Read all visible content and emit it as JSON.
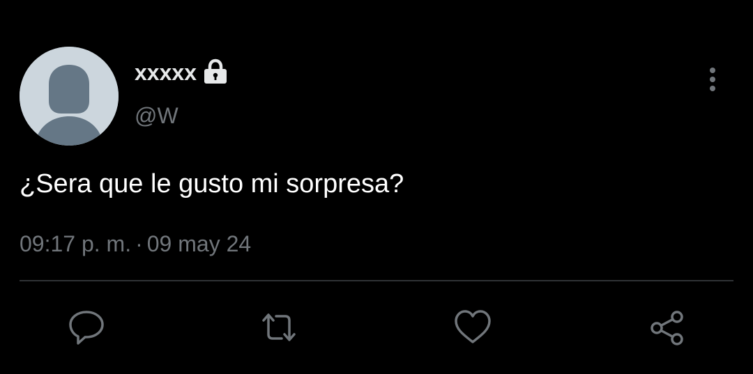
{
  "colors": {
    "background": "#000000",
    "text_primary": "#ffffff",
    "text_secondary": "#71767b",
    "divider": "#2f3336",
    "avatar_bg": "#ccd6dd",
    "avatar_figure": "#657786",
    "icon": "#71767b"
  },
  "author": {
    "display_name": "xxxxx",
    "handle": "@W",
    "protected_icon": "lock-icon",
    "avatar_icon": "default-avatar-icon"
  },
  "tweet": {
    "text": "¿Sera que le gusto mi sorpresa?",
    "time": "09:17 p. m.",
    "separator": "·",
    "date": "09 may 24"
  },
  "menu": {
    "icon": "more-vertical-icon"
  },
  "actions": [
    {
      "id": "reply",
      "icon": "reply-icon"
    },
    {
      "id": "retweet",
      "icon": "retweet-icon"
    },
    {
      "id": "like",
      "icon": "heart-icon"
    },
    {
      "id": "share",
      "icon": "share-icon"
    }
  ]
}
